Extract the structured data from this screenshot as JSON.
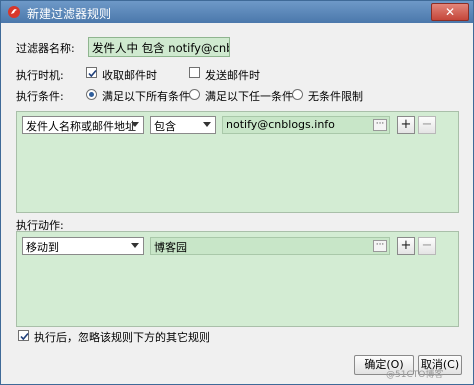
{
  "window": {
    "title": "新建过滤器规则",
    "close_label": "✕"
  },
  "form": {
    "name_label": "过滤器名称:",
    "name_value": "发件人中 包含 notify@cnblogs.ir",
    "timing_label": "执行时机:",
    "timing_options": [
      {
        "label": "收取邮件时",
        "checked": true
      },
      {
        "label": "发送邮件时",
        "checked": false
      }
    ],
    "condition_label": "执行条件:",
    "condition_options": [
      {
        "label": "满足以下所有条件",
        "selected": true
      },
      {
        "label": "满足以下任一条件",
        "selected": false
      },
      {
        "label": "无条件限制",
        "selected": false
      }
    ]
  },
  "conditions": [
    {
      "field": "发件人名称或邮件地址",
      "operator": "包含",
      "value": "notify@cnblogs.info",
      "add": "+",
      "remove": "−"
    }
  ],
  "actions_label": "执行动作:",
  "actions": [
    {
      "type": "移动到",
      "target": "博客园",
      "add": "+",
      "remove": "−"
    }
  ],
  "footer": {
    "skip_label": "执行后，忽略该规则下方的其它规则",
    "skip_checked": true,
    "ok_label": "确定(O)",
    "cancel_label": "取消(C)"
  },
  "watermark": "@51CTO博客",
  "colors": {
    "title_bar": "#4b78ab",
    "panel_bg": "#d3ecd3",
    "input_green": "#c8e6c8",
    "close_red": "#c4463a"
  }
}
